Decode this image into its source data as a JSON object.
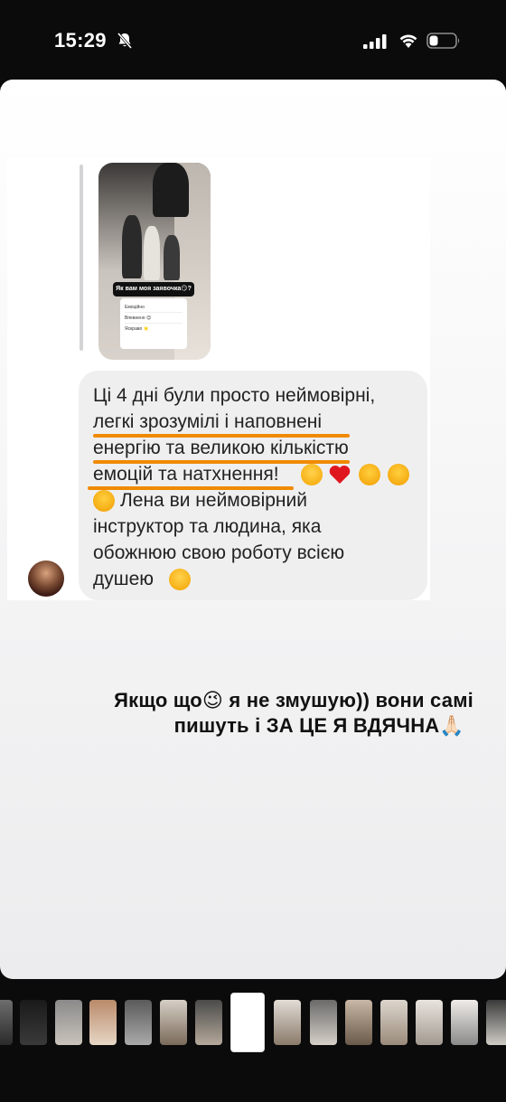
{
  "status_bar": {
    "time": "15:29"
  },
  "story": {
    "shared_post": {
      "question_sticker": "Як вам моя заявочка😏?",
      "poll_options": [
        "Емоційно",
        "Впевнено 😊",
        "Яскраво ⭐"
      ]
    },
    "message": {
      "lines": [
        "Ці 4 дні були просто неймовірні,",
        "легкі зрозумілі і наповнені",
        "енергію та великою кількістю",
        "емоцій та натхнення!",
        "Лена ви неймовірний",
        "інструктор та людина, яка",
        "обожнюю свою роботу всією",
        "душею"
      ],
      "highlight_color": "#f08a00"
    },
    "caption": {
      "line1": "Якщо що😉 я не змушую)) вони самі",
      "line2": "пишуть і ЗА ЦЕ Я ВДЯЧНА🙏🏻"
    }
  },
  "thumbnails": {
    "count": 15,
    "active_index": 6
  },
  "icons": [
    "bell-slash-icon",
    "cellular-signal-icon",
    "wifi-icon",
    "battery-icon"
  ]
}
